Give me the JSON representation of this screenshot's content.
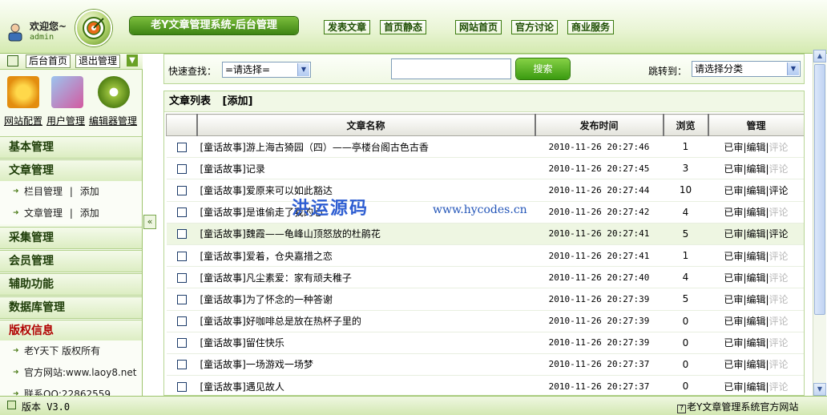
{
  "header": {
    "welcome": "欢迎您~",
    "username": "admin",
    "title": "老Y文章管理系统-后台管理",
    "nav": [
      "发表文章",
      "首页静态",
      "网站首页",
      "官方讨论",
      "商业服务"
    ]
  },
  "sidebar": {
    "top_buttons": [
      "后台首页",
      "退出管理"
    ],
    "quick_links": [
      "网站配置",
      "用户管理",
      "编辑器管理"
    ],
    "menus": [
      {
        "title": "基本管理"
      },
      {
        "title": "文章管理",
        "items": [
          {
            "label": "栏目管理",
            "sep": "|",
            "action": "添加"
          },
          {
            "label": "文章管理",
            "sep": "|",
            "action": "添加"
          }
        ]
      },
      {
        "title": "采集管理"
      },
      {
        "title": "会员管理"
      },
      {
        "title": "辅助功能"
      },
      {
        "title": "数据库管理"
      },
      {
        "title": "版权信息",
        "items": [
          {
            "label": "老Y天下 版权所有"
          },
          {
            "label": "官方网站:www.laoy8.net"
          },
          {
            "label": "联系QQ:22862559"
          }
        ]
      }
    ]
  },
  "search": {
    "quick_label": "快速查找：",
    "quick_select": "=请选择=",
    "input_value": "",
    "button": "搜索",
    "jump_label": "跳转到：",
    "jump_select": "请选择分类"
  },
  "list": {
    "title": "文章列表",
    "add": "[添加]",
    "columns": [
      "",
      "文章名称",
      "发布时间",
      "浏览",
      "管理"
    ],
    "actions": [
      "已审",
      "编辑",
      "评论"
    ],
    "rows": [
      {
        "name": "[童话故事]游上海古猗园（四）——亭楼台阁古色古香",
        "time": "2010-11-26 20:27:46",
        "views": "1",
        "comment_active": false
      },
      {
        "name": "[童话故事]记录",
        "time": "2010-11-26 20:27:45",
        "views": "3",
        "comment_active": false
      },
      {
        "name": "[童话故事]爱原来可以如此豁达",
        "time": "2010-11-26 20:27:44",
        "views": "10",
        "comment_active": true
      },
      {
        "name": "[童话故事]是谁偷走了我的心",
        "time": "2010-11-26 20:27:42",
        "views": "4",
        "comment_active": false
      },
      {
        "name": "[童话故事]魏霞——龟峰山顶怒放的杜鹃花",
        "time": "2010-11-26 20:27:41",
        "views": "5",
        "comment_active": true
      },
      {
        "name": "[童话故事]爱着，仓央嘉措之恋",
        "time": "2010-11-26 20:27:41",
        "views": "1",
        "comment_active": false
      },
      {
        "name": "[童话故事]凡尘素爱：家有顽夫稚子",
        "time": "2010-11-26 20:27:40",
        "views": "4",
        "comment_active": false
      },
      {
        "name": "[童话故事]为了怀念的一种答谢",
        "time": "2010-11-26 20:27:39",
        "views": "5",
        "comment_active": false
      },
      {
        "name": "[童话故事]好咖啡总是放在热杯子里的",
        "time": "2010-11-26 20:27:39",
        "views": "0",
        "comment_active": false
      },
      {
        "name": "[童话故事]留住快乐",
        "time": "2010-11-26 20:27:39",
        "views": "0",
        "comment_active": false
      },
      {
        "name": "[童话故事]一场游戏一场梦",
        "time": "2010-11-26 20:27:37",
        "views": "0",
        "comment_active": false
      },
      {
        "name": "[童话故事]遇见故人",
        "time": "2010-11-26 20:27:37",
        "views": "0",
        "comment_active": false
      }
    ]
  },
  "watermark": {
    "cn": "洪运源码",
    "url": "www.hycodes.cn"
  },
  "footer": {
    "version": "版本 V3.0",
    "link": "老Y文章管理系统官方网站"
  },
  "colors": {
    "accent": "#3e8413",
    "highlight_row": "#eef6e2",
    "copyright_title": "#b00000"
  }
}
